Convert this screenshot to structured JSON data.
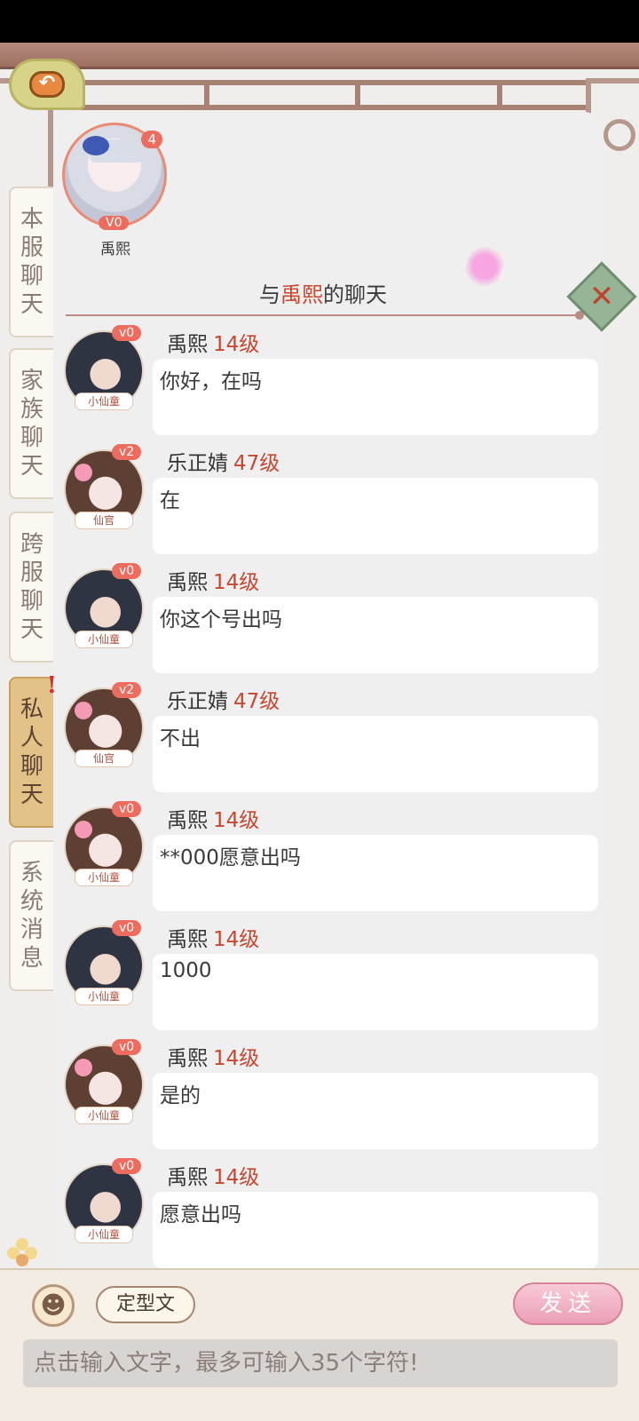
{
  "tabs": [
    {
      "label": "本服聊天",
      "chars": [
        "本",
        "服",
        "聊",
        "天"
      ],
      "active": false
    },
    {
      "label": "家族聊天",
      "chars": [
        "家",
        "族",
        "聊",
        "天"
      ],
      "active": false
    },
    {
      "label": "跨服聊天",
      "chars": [
        "跨",
        "服",
        "聊",
        "天"
      ],
      "active": false
    },
    {
      "label": "私人聊天",
      "chars": [
        "私",
        "人",
        "聊",
        "天"
      ],
      "active": true,
      "notice": "!"
    },
    {
      "label": "系统消息",
      "chars": [
        "系",
        "统",
        "消",
        "息"
      ],
      "active": false
    }
  ],
  "contact": {
    "name": "禹熙",
    "unread": "4",
    "vip": "V0"
  },
  "chat_title": {
    "prefix": "与",
    "name": "禹熙",
    "suffix": "的聊天"
  },
  "messages": [
    {
      "vip": "v0",
      "rank": "小仙童",
      "name": "禹熙",
      "level": "14级",
      "text": "你好，在吗"
    },
    {
      "vip": "v2",
      "rank": "仙官",
      "name": "乐正婧",
      "level": "47级",
      "text": "在"
    },
    {
      "vip": "v0",
      "rank": "小仙童",
      "name": "禹熙",
      "level": "14级",
      "text": "你这个号出吗"
    },
    {
      "vip": "v2",
      "rank": "仙官",
      "name": "乐正婧",
      "level": "47级",
      "text": "不出"
    },
    {
      "vip": "v0",
      "rank": "小仙童",
      "name": "禹熙",
      "level": "14级",
      "text": "**000愿意出吗"
    },
    {
      "vip": "v0",
      "rank": "小仙童",
      "name": "禹熙",
      "level": "14级",
      "text": "1000"
    },
    {
      "vip": "v0",
      "rank": "小仙童",
      "name": "禹熙",
      "level": "14级",
      "text": "是的"
    },
    {
      "vip": "v0",
      "rank": "小仙童",
      "name": "禹熙",
      "level": "14级",
      "text": "愿意出吗"
    }
  ],
  "bottom": {
    "preset_label": "定型文",
    "send_label": "发送",
    "input_placeholder": "点击输入文字，最多可输入35个字符!"
  }
}
